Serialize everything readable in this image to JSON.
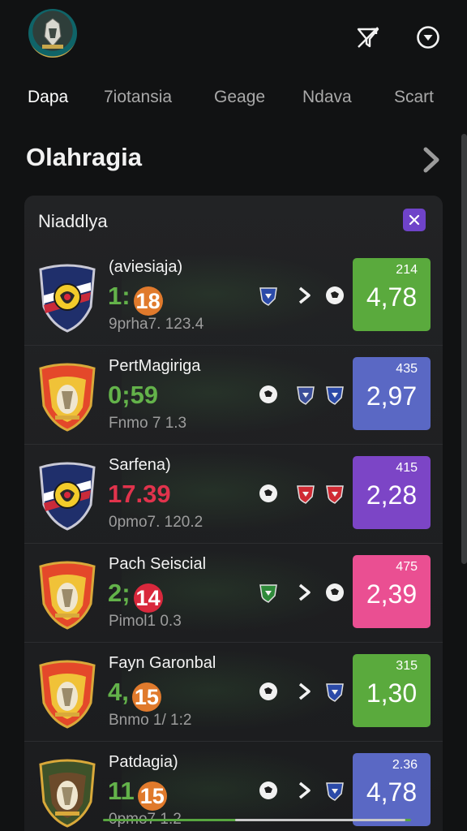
{
  "header": {
    "logo_icon": "club-crest-logo",
    "filter_icon": "filter-off-icon",
    "account_icon": "account-icon"
  },
  "tabs": [
    {
      "label": "Dapa",
      "active": true
    },
    {
      "label": "7iotansia",
      "active": false
    },
    {
      "label": "Geage",
      "active": false
    },
    {
      "label": "Ndava",
      "active": false
    },
    {
      "label": "Scart",
      "active": false
    }
  ],
  "section": {
    "title": "Olahragia"
  },
  "card": {
    "title": "Niaddlya",
    "matches": [
      {
        "name": "(aviesiaja)",
        "score": "1:",
        "badge": "18",
        "badge_color": "#e07a2c",
        "score_color": "green",
        "meta": "9prha7. 123.4",
        "crest": "blue",
        "odds_small": "214",
        "odds_main": "4,78",
        "odds_color": "#5aaa3d",
        "icons": [
          "blue-shield-icon",
          "chevron-right-icon",
          "ball-icon"
        ]
      },
      {
        "name": "PertMagiriga",
        "score": "0;59",
        "badge": "",
        "badge_color": "",
        "score_color": "green",
        "meta": "Fnmo 7 1.3",
        "crest": "orange",
        "odds_small": "435",
        "odds_main": "2,97",
        "odds_color": "#5a68c4",
        "icons": [
          "ball-icon",
          "flag-shield-icon",
          "blue-shield-icon"
        ]
      },
      {
        "name": "Sarfena)",
        "score": "17.39",
        "badge": "",
        "badge_color": "",
        "score_color": "red",
        "meta": "0pmo7. 120.2",
        "crest": "blue",
        "odds_small": "415",
        "odds_main": "2,28",
        "odds_color": "#7c45c6",
        "icons": [
          "ball-icon",
          "red-shield-icon",
          "red-shield-icon"
        ]
      },
      {
        "name": "Pach Seiscial",
        "score": "2;",
        "badge": "14",
        "badge_color": "#d9283c",
        "score_color": "green",
        "meta": "Pimol1 0.3",
        "crest": "orange",
        "odds_small": "475",
        "odds_main": "2,39",
        "odds_color": "#ea4f92",
        "icons": [
          "green-shield-icon",
          "chevron-right-icon",
          "ball-icon"
        ]
      },
      {
        "name": "Fayn Garonbal",
        "score": "4,",
        "badge": "15",
        "badge_color": "#e07a2c",
        "score_color": "green",
        "meta": "Bnmo 1/ 1:2",
        "crest": "orange",
        "odds_small": "315",
        "odds_main": "1,30",
        "odds_color": "#5aaa3d",
        "icons": [
          "ball-icon",
          "chevron-right-icon",
          "blue-shield-icon"
        ]
      },
      {
        "name": "Patdagia)",
        "score": "11",
        "badge": "15",
        "badge_color": "#e07a2c",
        "score_color": "green",
        "meta": "0pmo7 1.2",
        "crest": "olive",
        "odds_small": "2.36",
        "odds_main": "4,78",
        "odds_color": "#5a68c4",
        "icons": [
          "ball-icon",
          "chevron-right-icon",
          "blue-shield-icon"
        ]
      }
    ]
  }
}
